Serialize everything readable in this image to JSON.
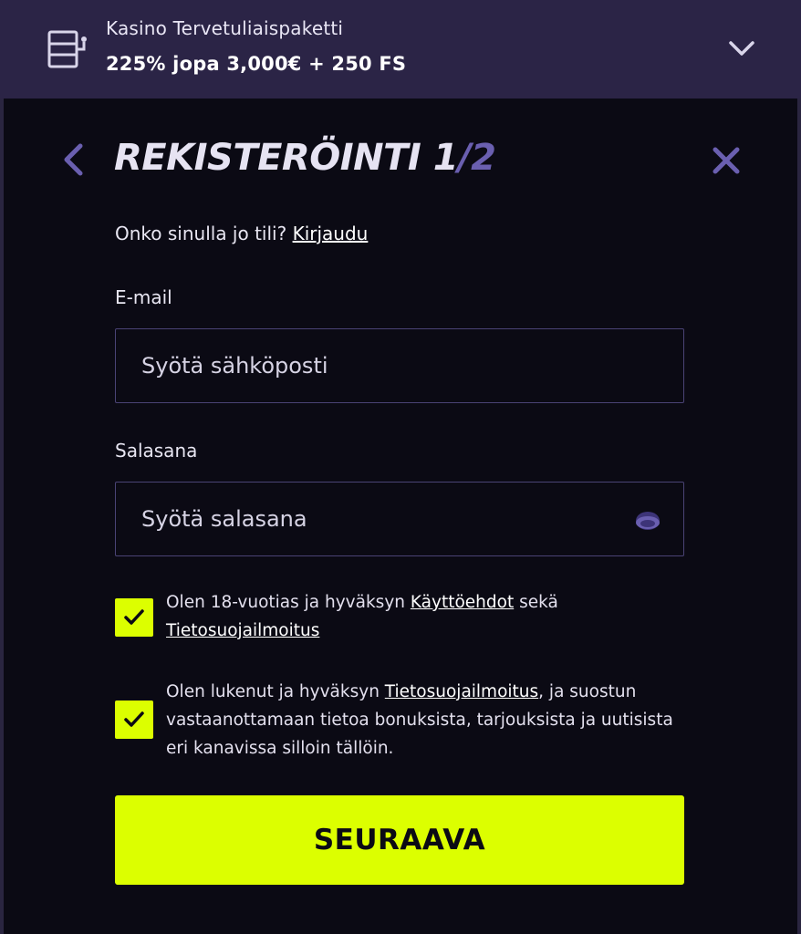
{
  "promo": {
    "title": "Kasino Tervetuliaispaketti",
    "offer": "225% jopa 3,000€ + 250 FS",
    "icon": "gift-icon",
    "expand_icon": "chevron-down-icon"
  },
  "header": {
    "title_prefix": "REKISTERÖINTI ",
    "step_current": "1",
    "step_separator": "/",
    "step_total": "2",
    "back_icon": "chevron-left-icon",
    "close_icon": "close-icon"
  },
  "login_prompt": {
    "text": "Onko sinulla jo tili? ",
    "link": "Kirjaudu"
  },
  "email": {
    "label": "E-mail",
    "value": "",
    "placeholder": "Syötä sähköposti"
  },
  "password": {
    "label": "Salasana",
    "value": "",
    "placeholder": "Syötä salasana",
    "toggle_icon": "eye-icon"
  },
  "consent_terms": {
    "checked": true,
    "text_before": "Olen 18-vuotias ja hyväksyn ",
    "link1": "Käyttöehdot",
    "text_middle": " sekä ",
    "link2": "Tietosuojailmoitus"
  },
  "consent_marketing": {
    "checked": true,
    "text_before": "Olen lukenut ja hyväksyn ",
    "link": "Tietosuojailmoitus",
    "text_after": ", ja suostun vastaanottamaan tietoa bonuksista, tarjouksista ja uutisista eri kanavissa silloin tällöin."
  },
  "submit": {
    "label": "SEURAAVA"
  },
  "colors": {
    "background": "#0b0a14",
    "banner": "#2b2446",
    "accent": "#dcff00",
    "purple": "#6a5fb0",
    "field_border": "#4a4375"
  }
}
